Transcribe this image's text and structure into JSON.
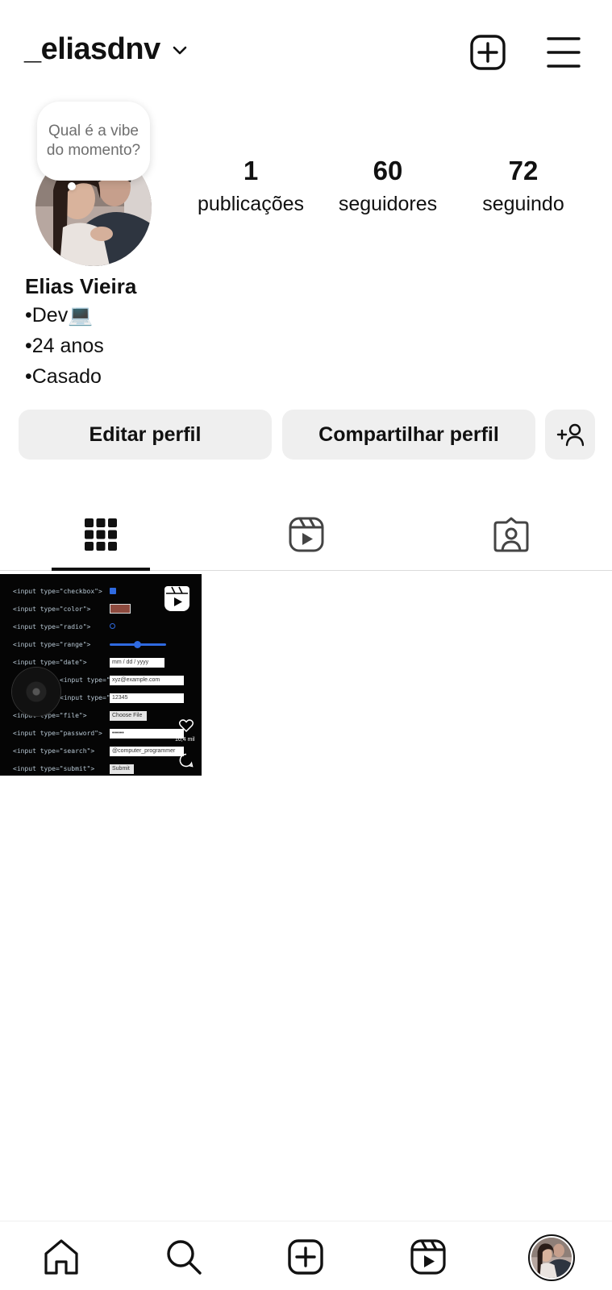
{
  "header": {
    "username": "_eliasdnv",
    "icons": [
      "chevron-down-icon",
      "new-post-icon",
      "menu-icon"
    ]
  },
  "profile": {
    "note": "Qual é a vibe do momento?",
    "stats": {
      "posts": {
        "value": "1",
        "label": "publicações"
      },
      "followers": {
        "value": "60",
        "label": "seguidores"
      },
      "following": {
        "value": "72",
        "label": "seguindo"
      }
    },
    "name": "Elias Vieira",
    "bio": [
      "•Dev💻",
      "•24 anos",
      "•Casado"
    ]
  },
  "actions": {
    "edit_label": "Editar perfil",
    "share_label": "Compartilhar perfil"
  },
  "tabs": [
    {
      "name": "grid",
      "icon": "grid-icon",
      "active": true
    },
    {
      "name": "reels",
      "icon": "reels-icon",
      "active": false
    },
    {
      "name": "tagged",
      "icon": "tagged-icon",
      "active": false
    }
  ],
  "post": {
    "code_lines": [
      "<input type=\"checkbox\">",
      "<input type=\"color\">",
      "<input type=\"radio\">",
      "<input type=\"range\">",
      "<input type=\"date\">",
      "<input type=\"email\">",
      "<input type=\"number\" >",
      "<input type=\"file\">",
      "<input type=\"password\">",
      "<input type=\"search\">",
      "<input type=\"submit\">"
    ],
    "demo_date": "mm / dd / yyyy",
    "demo_email": "xyz@example.com",
    "demo_number": "12345",
    "demo_file": "Choose File",
    "demo_password": "••••••",
    "demo_search": "@computer_programmer",
    "demo_submit": "Submit",
    "likes": "10,4 mil"
  },
  "bottom_nav": [
    "home-icon",
    "search-icon",
    "create-icon",
    "reels-icon",
    "profile-avatar"
  ],
  "colors": {
    "text": "#111111",
    "button_bg": "#efefef",
    "divider": "#dbdbdb",
    "note_text": "#6f6f6f"
  }
}
